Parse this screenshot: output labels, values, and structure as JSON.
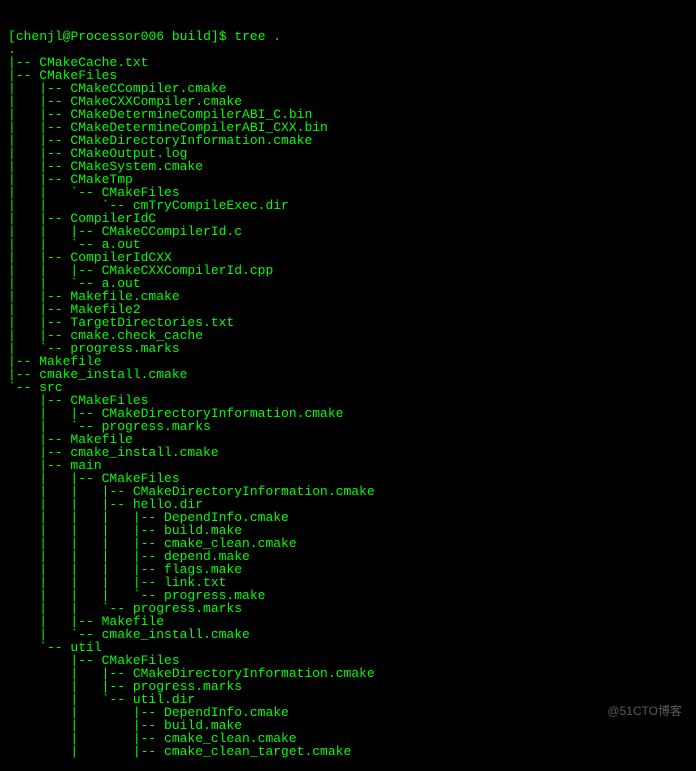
{
  "prompt": {
    "user": "chenjl",
    "host": "Processor006",
    "path": "build",
    "command": "tree ."
  },
  "lines": [
    ".",
    "|-- CMakeCache.txt",
    "|-- CMakeFiles",
    "|   |-- CMakeCCompiler.cmake",
    "|   |-- CMakeCXXCompiler.cmake",
    "|   |-- CMakeDetermineCompilerABI_C.bin",
    "|   |-- CMakeDetermineCompilerABI_CXX.bin",
    "|   |-- CMakeDirectoryInformation.cmake",
    "|   |-- CMakeOutput.log",
    "|   |-- CMakeSystem.cmake",
    "|   |-- CMakeTmp",
    "|   |   `-- CMakeFiles",
    "|   |       `-- cmTryCompileExec.dir",
    "|   |-- CompilerIdC",
    "|   |   |-- CMakeCCompilerId.c",
    "|   |   `-- a.out",
    "|   |-- CompilerIdCXX",
    "|   |   |-- CMakeCXXCompilerId.cpp",
    "|   |   `-- a.out",
    "|   |-- Makefile.cmake",
    "|   |-- Makefile2",
    "|   |-- TargetDirectories.txt",
    "|   |-- cmake.check_cache",
    "|   `-- progress.marks",
    "|-- Makefile",
    "|-- cmake_install.cmake",
    "`-- src",
    "    |-- CMakeFiles",
    "    |   |-- CMakeDirectoryInformation.cmake",
    "    |   `-- progress.marks",
    "    |-- Makefile",
    "    |-- cmake_install.cmake",
    "    |-- main",
    "    |   |-- CMakeFiles",
    "    |   |   |-- CMakeDirectoryInformation.cmake",
    "    |   |   |-- hello.dir",
    "    |   |   |   |-- DependInfo.cmake",
    "    |   |   |   |-- build.make",
    "    |   |   |   |-- cmake_clean.cmake",
    "    |   |   |   |-- depend.make",
    "    |   |   |   |-- flags.make",
    "    |   |   |   |-- link.txt",
    "    |   |   |   `-- progress.make",
    "    |   |   `-- progress.marks",
    "    |   |-- Makefile",
    "    |   `-- cmake_install.cmake",
    "    `-- util",
    "        |-- CMakeFiles",
    "        |   |-- CMakeDirectoryInformation.cmake",
    "        |   |-- progress.marks",
    "        |   `-- util.dir",
    "        |       |-- DependInfo.cmake",
    "        |       |-- build.make",
    "        |       |-- cmake_clean.cmake",
    "        |       |-- cmake_clean_target.cmake"
  ],
  "watermark": "@51CTO博客"
}
